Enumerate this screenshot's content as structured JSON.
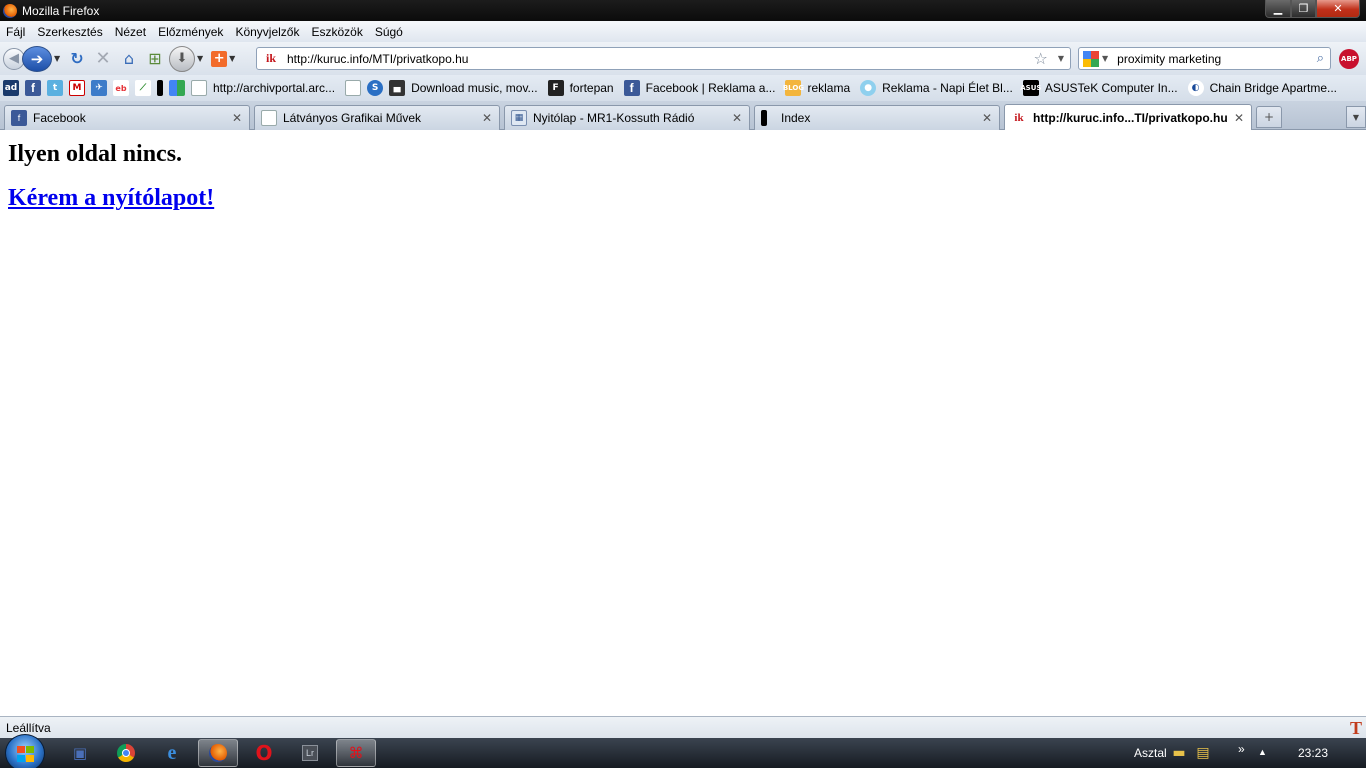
{
  "window": {
    "title": "Mozilla Firefox"
  },
  "menu": [
    "Fájl",
    "Szerkesztés",
    "Nézet",
    "Előzmények",
    "Könyvjelzők",
    "Eszközök",
    "Súgó"
  ],
  "nav": {
    "url": "http://kuruc.info/MTI/privatkopo.hu",
    "search_query": "proximity marketing",
    "abp_label": "ABP"
  },
  "bookmarks": [
    {
      "label": "http://archivportal.arc..."
    },
    {
      "label": "Download music, mov..."
    },
    {
      "label": "fortepan"
    },
    {
      "label": "Facebook | Reklama a..."
    },
    {
      "label": "reklama"
    },
    {
      "label": "Reklama - Napi Élet Bl..."
    },
    {
      "label": "ASUSTeK Computer In..."
    },
    {
      "label": "Chain Bridge Apartme..."
    }
  ],
  "tabs": [
    {
      "label": "Facebook"
    },
    {
      "label": "Látványos Grafikai Művek"
    },
    {
      "label": "Nyitólap - MR1-Kossuth Rádió"
    },
    {
      "label": "Index"
    },
    {
      "label": "http://kuruc.info...TI/privatkopo.hu"
    }
  ],
  "content": {
    "heading": "Ilyen oldal nincs.",
    "link": "Kérem a nyítólapot!"
  },
  "status": {
    "text": "Leállítva"
  },
  "taskbar": {
    "desktop_label": "Asztal",
    "clock": "23:23"
  }
}
